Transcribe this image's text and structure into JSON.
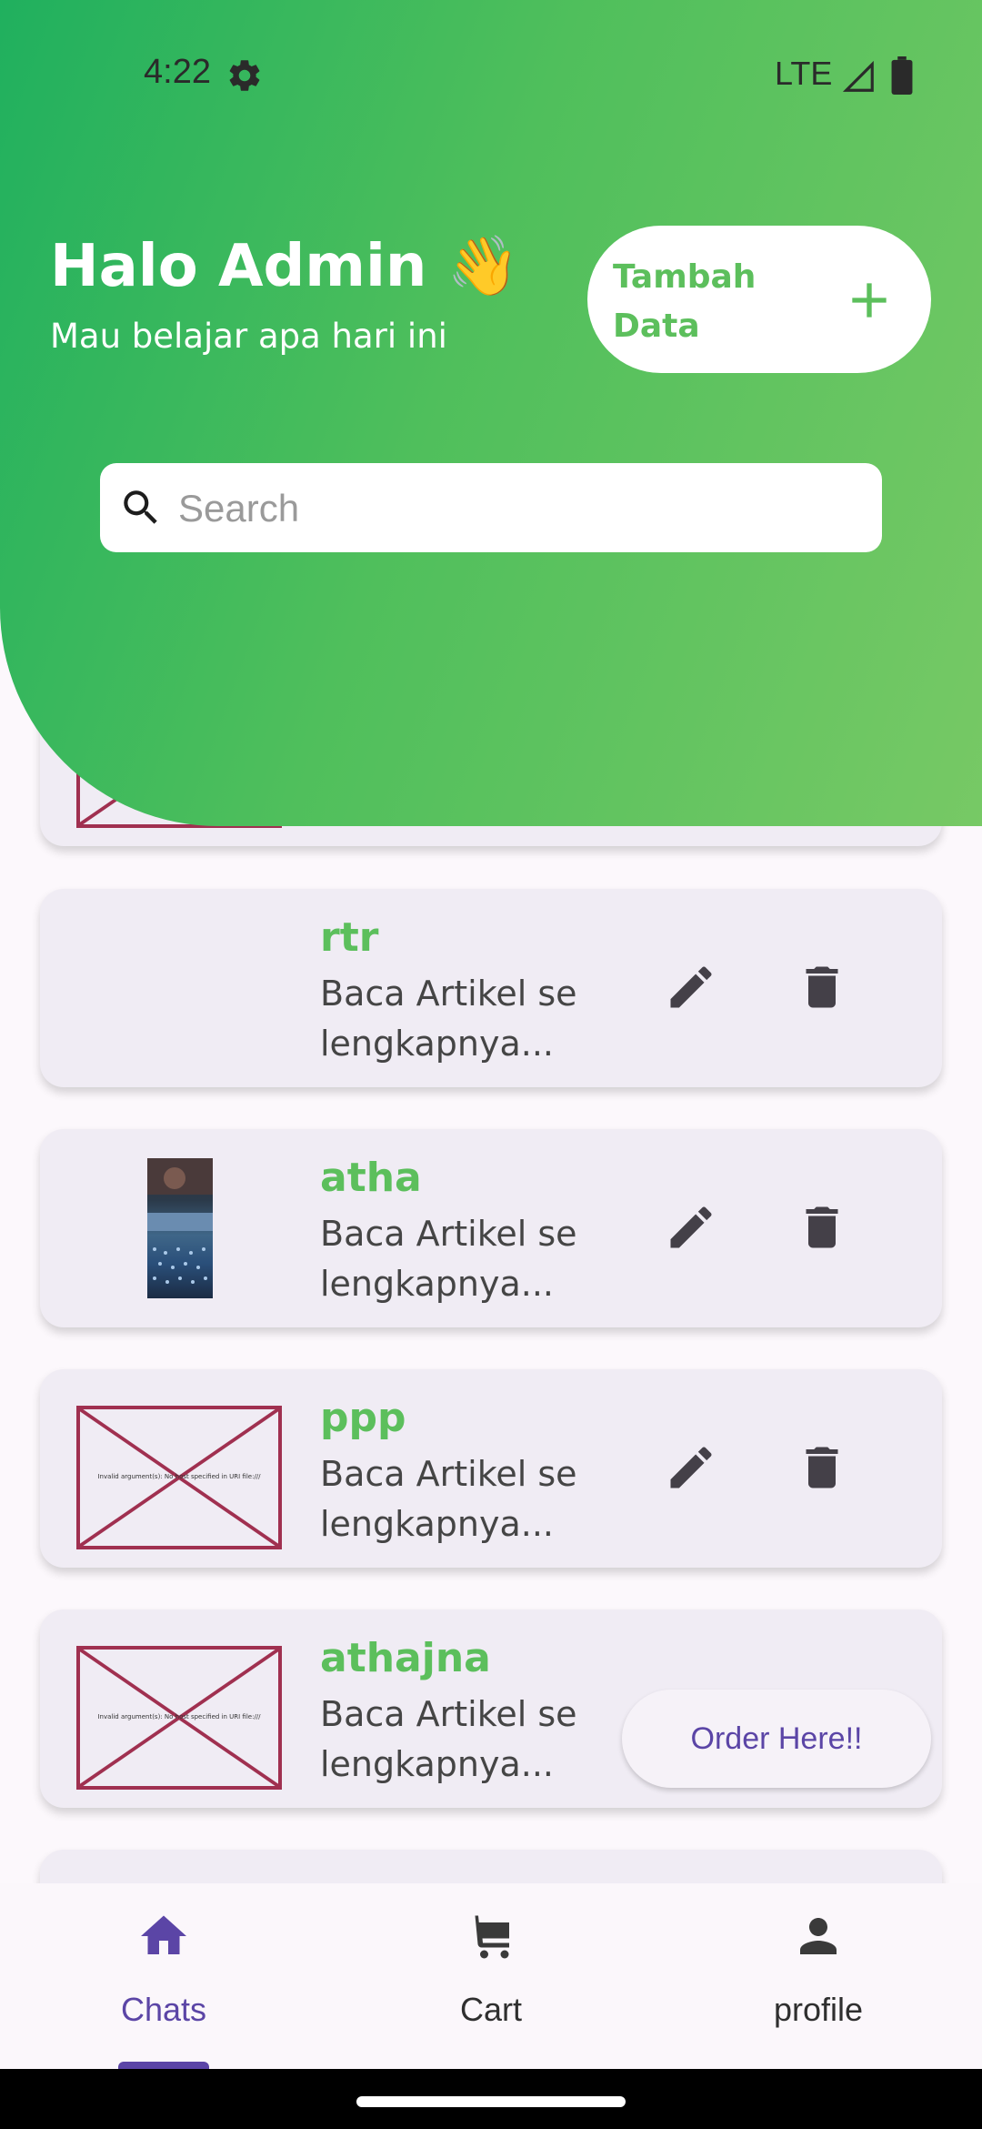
{
  "status": {
    "time": "4:22",
    "network": "LTE"
  },
  "header": {
    "greeting": "Halo Admin 👋",
    "subtitle": "Mau belajar apa hari ini",
    "add_button_label": "Tambah Data"
  },
  "search": {
    "placeholder": "Search",
    "value": ""
  },
  "items": [
    {
      "title": "",
      "description": "",
      "image": "broken",
      "actions": "none"
    },
    {
      "title": "rtr",
      "description": "Baca Artikel se lengkapnya...",
      "image": "none",
      "actions": "edit-delete"
    },
    {
      "title": "atha",
      "description": "Baca Artikel se lengkapnya...",
      "image": "photo",
      "actions": "edit-delete"
    },
    {
      "title": "ppp",
      "description": "Baca Artikel se lengkapnya...",
      "image": "broken",
      "image_error": "Invalid argument(s): No host specified in URI file:///",
      "actions": "edit-delete"
    },
    {
      "title": "athajna",
      "description": "Baca Artikel se lengkapnya...",
      "image": "broken",
      "image_error": "Invalid argument(s): No host specified in URI file:///",
      "actions": "order",
      "order_label": "Order Here!!"
    }
  ],
  "nav": {
    "items": [
      {
        "label": "Chats",
        "icon": "home-icon",
        "active": true
      },
      {
        "label": "Cart",
        "icon": "cart-icon",
        "active": false
      },
      {
        "label": "profile",
        "icon": "person-icon",
        "active": false
      }
    ]
  },
  "colors": {
    "header_start": "#20b05e",
    "header_end": "#77c965",
    "title_green": "#5cbf5c",
    "accent_purple": "#5b45a6",
    "card_bg": "#f0ecf4"
  }
}
